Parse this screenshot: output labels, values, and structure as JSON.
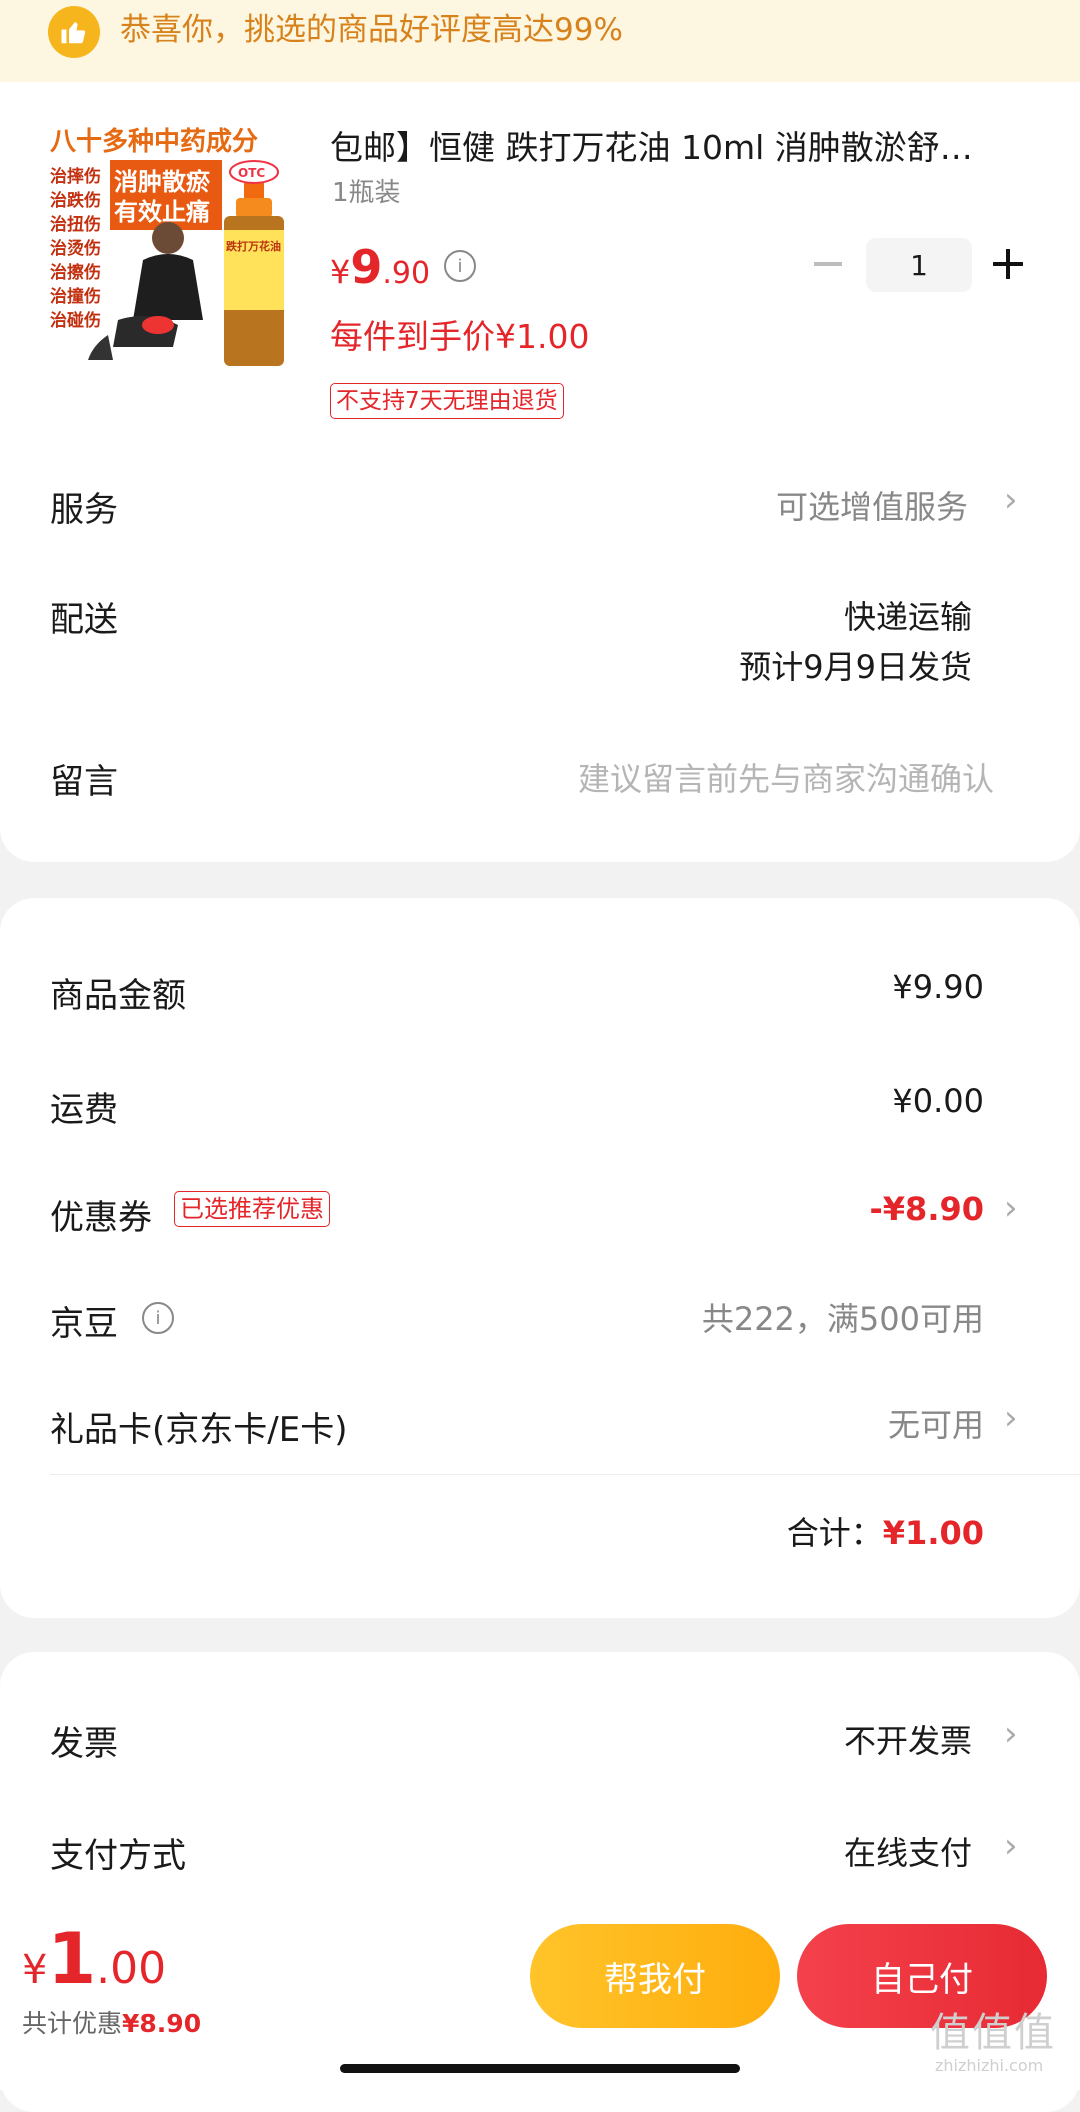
{
  "banner": {
    "text": "恭喜你，挑选的商品好评度高达99%",
    "icon": "thumbs-up-icon"
  },
  "product": {
    "image_lines": [
      "八十多种中药成分",
      "消肿散瘀",
      "有效止痛",
      "治摔伤",
      "治跌伤",
      "治扭伤",
      "治烫伤",
      "治擦伤",
      "治撞伤",
      "治碰伤",
      "OTC",
      "跌打万花油"
    ],
    "title": "包邮】恒健 跌打万花油 10ml 消肿散淤舒…",
    "spec": "1瓶装",
    "price_yen": "¥",
    "price_int": "9",
    "price_dec": ".90",
    "hand_price": "每件到手价¥1.00",
    "return_tag": "不支持7天无理由退货",
    "quantity": "1",
    "minus": "−",
    "plus": "+"
  },
  "order_rows": {
    "service_label": "服务",
    "service_value": "可选增值服务",
    "delivery_label": "配送",
    "delivery_value": "快递运输",
    "delivery_date": "预计9月9日发货",
    "message_label": "留言",
    "message_placeholder": "建议留言前先与商家沟通确认"
  },
  "summary": {
    "goods_label": "商品金额",
    "goods_value": "¥9.90",
    "shipping_label": "运费",
    "shipping_value": "¥0.00",
    "coupon_label": "优惠券",
    "coupon_tag": "已选推荐优惠",
    "coupon_value": "-¥8.90",
    "beans_label": "京豆",
    "beans_value": "共222，满500可用",
    "giftcard_label": "礼品卡(京东卡/E卡)",
    "giftcard_value": "无可用",
    "total_label": "合计：",
    "total_value": "¥1.00"
  },
  "extra": {
    "invoice_label": "发票",
    "invoice_value": "不开发票",
    "payment_label": "支付方式",
    "payment_value": "在线支付"
  },
  "bottom_bar": {
    "total_yen": "¥",
    "total_int": "1",
    "total_dec": ".00",
    "saving_label": "共计优惠",
    "saving_value": "¥8.90",
    "help_pay": "帮我付",
    "self_pay": "自己付"
  },
  "watermark": {
    "text": "值值值",
    "sub": "zhizhizhi.com"
  },
  "colors": {
    "accent": "#e4262b",
    "banner_bg": "#fdf6e0",
    "banner_text": "#d7821c",
    "help_btn": "#ffb81a",
    "self_btn": "#ec3039"
  }
}
